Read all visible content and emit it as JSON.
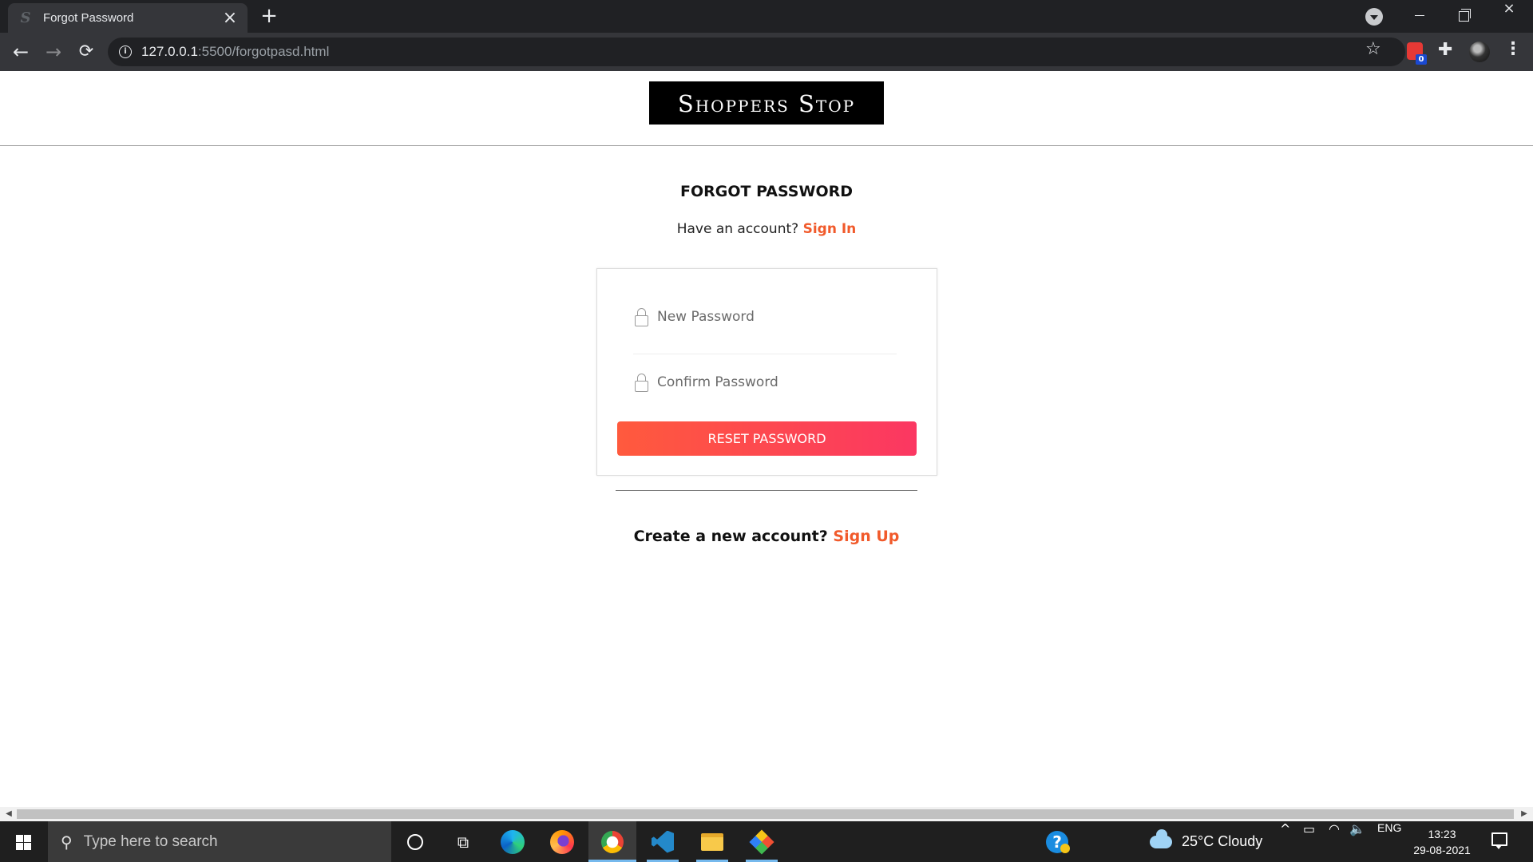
{
  "browser": {
    "tab_title": "Forgot Password",
    "tab_favicon": "S",
    "url_host": "127.0.0.1",
    "url_rest": ":5500/forgotpasd.html",
    "extension_badge": "0",
    "icons": {
      "back": "←",
      "forward": "→",
      "reload": "⟳",
      "star": "☆",
      "puzzle": "✚",
      "menu": "⋮",
      "close": "×",
      "new_tab": "+",
      "info": "i"
    }
  },
  "page": {
    "logo": "Shoppers Stop",
    "title": "FORGOT PASSWORD",
    "have_account_text": "Have an account?",
    "sign_in_link": "Sign In",
    "new_password_placeholder": "New Password",
    "confirm_password_placeholder": "Confirm Password",
    "reset_button": "RESET PASSWORD",
    "create_account_text": "Create a new account?",
    "sign_up_link": "Sign Up",
    "accent_color": "#f15a2b"
  },
  "taskbar": {
    "search_placeholder": "Type here to search",
    "weather": "25°C  Cloudy",
    "language": "ENG",
    "time": "13:23",
    "date": "29-08-2021",
    "icons": {
      "search": "⚲",
      "task_view": "⧉",
      "help": "?",
      "chevron": "^",
      "battery": "▭",
      "wifi": "◠",
      "volume": "🔈"
    }
  }
}
